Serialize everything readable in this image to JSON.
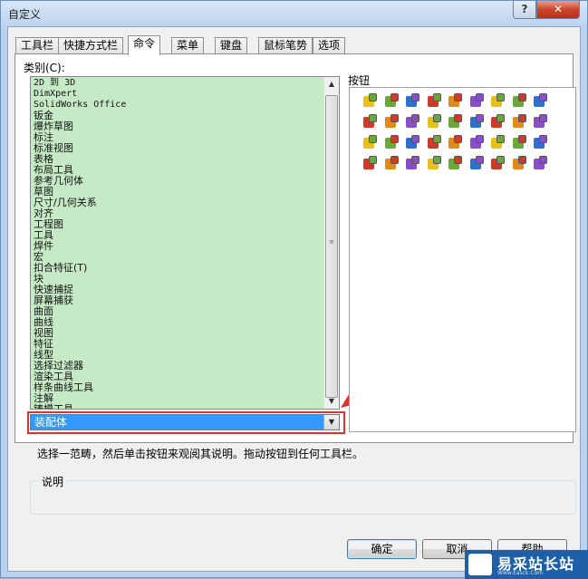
{
  "window": {
    "title": "自定义",
    "help_glyph": "?",
    "close_glyph": "✕"
  },
  "tabs": [
    {
      "label": "工具栏"
    },
    {
      "label": "快捷方式栏"
    },
    {
      "label": "命令"
    },
    {
      "label": "菜单"
    },
    {
      "label": "键盘"
    },
    {
      "label": "鼠标笔势"
    },
    {
      "label": "选项"
    }
  ],
  "active_tab": "命令",
  "categories": {
    "label": "类别(C):",
    "items": [
      "2D 到 3D",
      "DimXpert",
      "SolidWorks Office",
      "钣金",
      "爆炸草图",
      "标注",
      "标准视图",
      "表格",
      "布局工具",
      "参考几何体",
      "草图",
      "尺寸/几何关系",
      "对齐",
      "工程图",
      "工具",
      "焊件",
      "宏",
      "扣合特征(T)",
      "块",
      "快速捕捉",
      "屏幕捕获",
      "曲面",
      "曲线",
      "视图",
      "特征",
      "线型",
      "选择过滤器",
      "渲染工具",
      "样条曲线工具",
      "注解",
      "铸模工具"
    ],
    "selected": "装配体"
  },
  "scrollbar": {
    "up": "▲",
    "down": "▼",
    "grip": "≡"
  },
  "buttons_panel": {
    "label": "按钮",
    "icon_count": 36
  },
  "help_text": "选择一范畴，然后单击按钮来观阅其说明。拖动按钮到任何工具栏。",
  "description": {
    "label": "说明"
  },
  "dialog_buttons": {
    "ok": "确定",
    "cancel": "取消",
    "help": "帮助"
  },
  "watermark": {
    "text": "易采站长站",
    "sub": "Www.Easck.Com"
  },
  "colors": {
    "list_bg": "#c6e9c6",
    "selection": "#3399ff",
    "annotation_red": "#d9342f"
  }
}
